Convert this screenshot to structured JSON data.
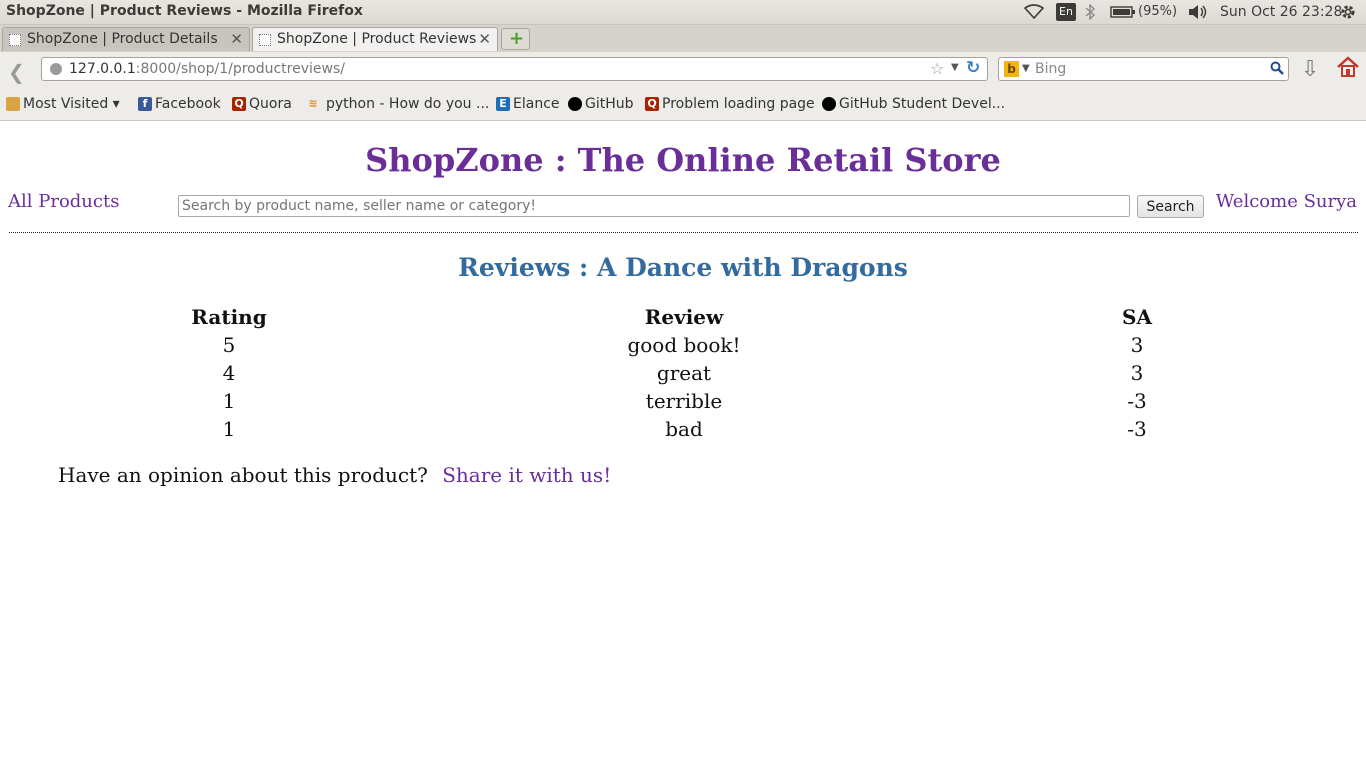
{
  "panel": {
    "window_title": "ShopZone | Product Reviews - Mozilla Firefox",
    "lang": "En",
    "battery": "(95%)",
    "clock": "Sun Oct 26 23:28"
  },
  "tabs": [
    {
      "label": "ShopZone | Product Details"
    },
    {
      "label": "ShopZone | Product Reviews"
    }
  ],
  "nav": {
    "url_host": "127.0.0.1",
    "url_path": ":8000/shop/1/productreviews/",
    "search_engine": "Bing",
    "search_placeholder": "Bing"
  },
  "bookmarks": [
    {
      "label": "Most Visited ▾",
      "icon": "folder-icon"
    },
    {
      "label": "Facebook",
      "icon": "facebook-icon"
    },
    {
      "label": "Quora",
      "icon": "quora-icon"
    },
    {
      "label": "python - How do you ...",
      "icon": "stackoverflow-icon"
    },
    {
      "label": "Elance",
      "icon": "elance-icon"
    },
    {
      "label": "GitHub",
      "icon": "github-icon"
    },
    {
      "label": "Problem loading page",
      "icon": "quora-icon"
    },
    {
      "label": "GitHub Student Devel...",
      "icon": "github-icon"
    }
  ],
  "page": {
    "site_title": "ShopZone : The Online Retail Store",
    "all_products": "All Products",
    "search_placeholder": "Search by product name, seller name or category!",
    "search_button": "Search",
    "welcome": "Welcome Surya",
    "reviews_heading": "Reviews : A Dance with Dragons",
    "table": {
      "headers": [
        "Rating",
        "Review",
        "SA"
      ],
      "rows": [
        [
          "5",
          "good book!",
          "3"
        ],
        [
          "4",
          "great",
          "3"
        ],
        [
          "1",
          "terrible",
          "-3"
        ],
        [
          "1",
          "bad",
          "-3"
        ]
      ]
    },
    "opinion_text": "Have an opinion about this product?",
    "share_link": "Share it with us!"
  },
  "colors": {
    "brand_purple": "#6a2e99",
    "heading_blue": "#336b9e"
  }
}
